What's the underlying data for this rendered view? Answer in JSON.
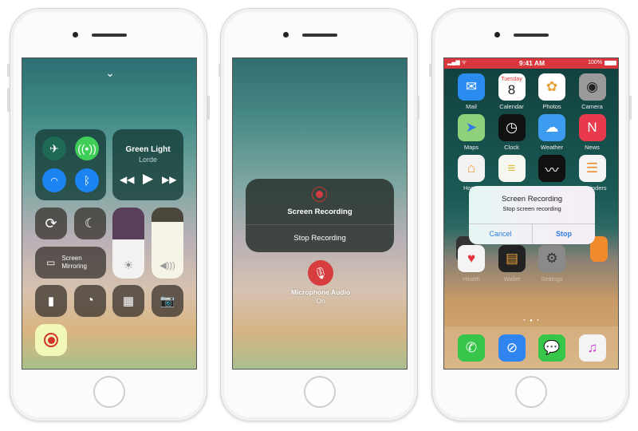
{
  "phone1": {
    "now_playing": {
      "title": "Green Light",
      "artist": "Lorde"
    },
    "screen_mirroring": {
      "line1": "Screen",
      "line2": "Mirroring"
    },
    "brightness_level": 0.45,
    "volume_level": 0.8
  },
  "phone2": {
    "popup_title": "Screen Recording",
    "stop_button": "Stop Recording",
    "mic_label": "Microphone Audio",
    "mic_state": "On"
  },
  "phone3": {
    "status": {
      "time": "9:41 AM",
      "battery": "100%",
      "bar_color": "#d9363e"
    },
    "calendar": {
      "day": "Tuesday",
      "date": "8"
    },
    "apps": [
      {
        "label": "Mail",
        "icon": "mail-icon",
        "color": "#2a8cf0"
      },
      {
        "label": "Calendar",
        "icon": "calendar-icon",
        "color": "#ffffff"
      },
      {
        "label": "Photos",
        "icon": "photos-icon",
        "color": "#ffffff"
      },
      {
        "label": "Camera",
        "icon": "camera-icon",
        "color": "#9a9a9a"
      },
      {
        "label": "Maps",
        "icon": "maps-icon",
        "color": "#8fd07a"
      },
      {
        "label": "Clock",
        "icon": "clock-icon",
        "color": "#111111"
      },
      {
        "label": "Weather",
        "icon": "weather-icon",
        "color": "#3d9cf0"
      },
      {
        "label": "News",
        "icon": "news-icon",
        "color": "#e83a4d"
      },
      {
        "label": "Home",
        "icon": "home-icon",
        "color": "#f2f2f2"
      },
      {
        "label": "Notes",
        "icon": "notes-icon",
        "color": "#f7f7f2"
      },
      {
        "label": "Stocks",
        "icon": "stocks-icon",
        "color": "#111111"
      },
      {
        "label": "Reminders",
        "icon": "reminders-icon",
        "color": "#f5f5f5"
      }
    ],
    "row5": [
      {
        "label": "Health",
        "icon": "health-icon"
      },
      {
        "label": "Wallet",
        "icon": "wallet-icon"
      },
      {
        "label": "Settings",
        "icon": "settings-icon"
      }
    ],
    "dock": [
      {
        "icon": "phone-icon",
        "color": "#37c64a"
      },
      {
        "icon": "safari-icon",
        "color": "#2f84ef"
      },
      {
        "icon": "messages-icon",
        "color": "#37c64a"
      },
      {
        "icon": "music-icon",
        "color": "#f4f4f4"
      }
    ],
    "alert": {
      "title": "Screen Recording",
      "message": "Stop screen recording",
      "cancel": "Cancel",
      "stop": "Stop"
    }
  }
}
